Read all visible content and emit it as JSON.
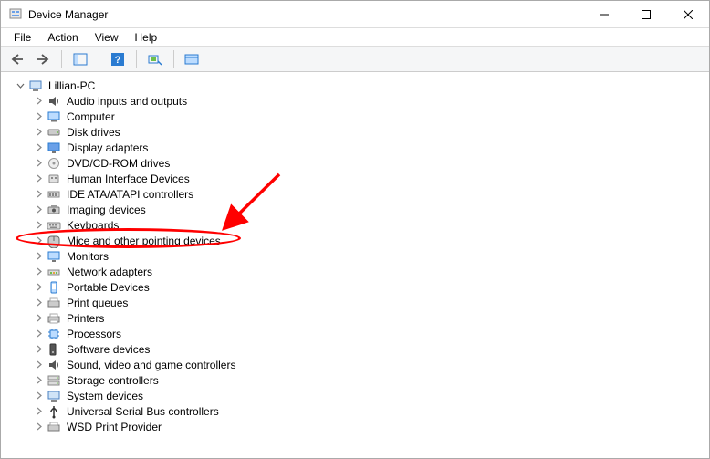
{
  "window": {
    "title": "Device Manager"
  },
  "menu": {
    "file": "File",
    "action": "Action",
    "view": "View",
    "help": "Help"
  },
  "tree": {
    "root": {
      "label": "Lillian-PC",
      "expanded": true
    },
    "items": [
      {
        "label": "Audio inputs and outputs",
        "icon": "audio"
      },
      {
        "label": "Computer",
        "icon": "computer"
      },
      {
        "label": "Disk drives",
        "icon": "disk"
      },
      {
        "label": "Display adapters",
        "icon": "display"
      },
      {
        "label": "DVD/CD-ROM drives",
        "icon": "dvd"
      },
      {
        "label": "Human Interface Devices",
        "icon": "hid"
      },
      {
        "label": "IDE ATA/ATAPI controllers",
        "icon": "ide"
      },
      {
        "label": "Imaging devices",
        "icon": "imaging"
      },
      {
        "label": "Keyboards",
        "icon": "keyboard"
      },
      {
        "label": "Mice and other pointing devices",
        "icon": "mouse",
        "highlighted": true
      },
      {
        "label": "Monitors",
        "icon": "monitor"
      },
      {
        "label": "Network adapters",
        "icon": "network"
      },
      {
        "label": "Portable Devices",
        "icon": "portable"
      },
      {
        "label": "Print queues",
        "icon": "printqueue"
      },
      {
        "label": "Printers",
        "icon": "printer"
      },
      {
        "label": "Processors",
        "icon": "processor"
      },
      {
        "label": "Software devices",
        "icon": "software"
      },
      {
        "label": "Sound, video and game controllers",
        "icon": "sound"
      },
      {
        "label": "Storage controllers",
        "icon": "storage"
      },
      {
        "label": "System devices",
        "icon": "system"
      },
      {
        "label": "Universal Serial Bus controllers",
        "icon": "usb"
      },
      {
        "label": "WSD Print Provider",
        "icon": "wsd"
      }
    ]
  },
  "annotation": {
    "type": "red-circle-with-arrow",
    "target_item_index": 9
  }
}
